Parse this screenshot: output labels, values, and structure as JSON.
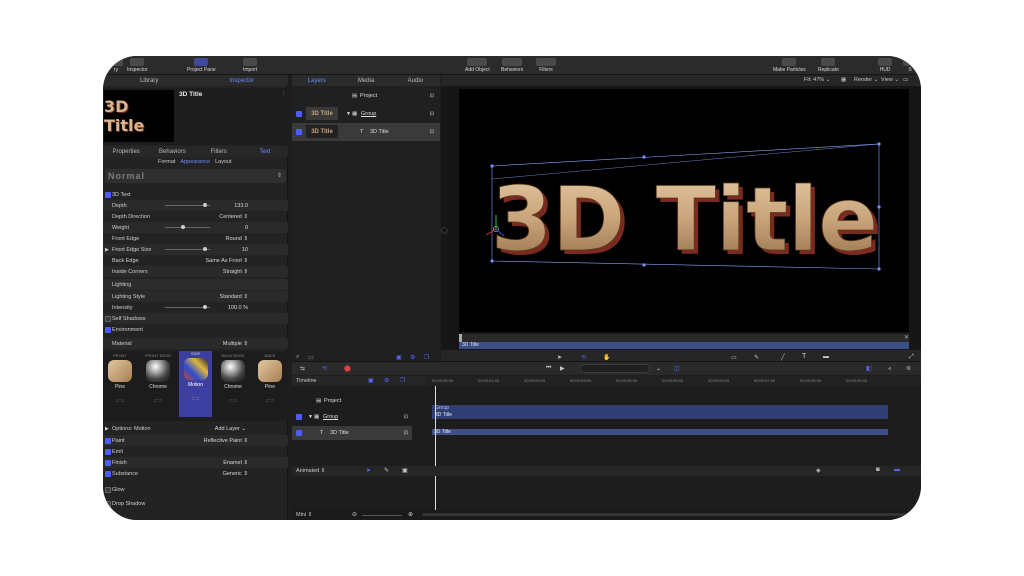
{
  "toolbar": {
    "left_items": [
      "ry",
      "Inspector",
      "Project Pane",
      "Import"
    ],
    "center_items": [
      "Add Object",
      "Behaviors",
      "Filters"
    ],
    "right_items": [
      "Make Particles",
      "Replicate",
      "HUD",
      "S"
    ]
  },
  "left_tabs": [
    "Library",
    "Inspector"
  ],
  "preview": {
    "thumb_text": "3D Title",
    "title": "3D Title"
  },
  "inspector_tabs": [
    "Properties",
    "Behaviors",
    "Filters",
    "Text"
  ],
  "inspector_subtabs": [
    "Format",
    "Appearance",
    "Layout"
  ],
  "preset": "Normal",
  "text_props": {
    "section_3d": "3D Text",
    "rows": [
      {
        "label": "Depth",
        "value": "133.0",
        "slider": 0.85
      },
      {
        "label": "Depth Direction",
        "value": "Centered ⇕"
      },
      {
        "label": "Weight",
        "value": "0",
        "slider": 0.38
      },
      {
        "label": "Front Edge",
        "value": "Round ⇕"
      },
      {
        "label": "Front Edge Size",
        "value": "10",
        "slider": 0.85
      },
      {
        "label": "Back Edge",
        "value": "Same As Front ⇕"
      },
      {
        "label": "Inside Corners",
        "value": "Straight ⇕"
      }
    ],
    "lighting_header": "Lighting",
    "lighting_rows": [
      {
        "label": "Lighting Style",
        "value": "Standard ⇕"
      },
      {
        "label": "Intensity",
        "value": "100.0 %",
        "slider": 0.85
      }
    ],
    "self_shadows": "Self Shadows",
    "environment": "Environment",
    "material_label": "Material",
    "material_value": "Multiple ⇕"
  },
  "materials": [
    {
      "head": "FRONT",
      "name": "Pine"
    },
    {
      "head": "FRONT EDGE",
      "name": "Chrome"
    },
    {
      "head": "SIDE",
      "name": "Motion"
    },
    {
      "head": "BACK EDGE",
      "name": "Chrome"
    },
    {
      "head": "BACK",
      "name": "Pine"
    }
  ],
  "options": {
    "label": "Options: Motion",
    "add_layer": "Add Layer ⌄"
  },
  "paint_rows": [
    {
      "label": "Paint",
      "value": "Reflective Paint ⇕"
    },
    {
      "label": "Emit",
      "value": ""
    },
    {
      "label": "Finish",
      "value": "Enamel ⇕"
    },
    {
      "label": "Substance",
      "value": "Generic ⇕"
    }
  ],
  "glow": "Glow",
  "drop_shadow": "Drop Shadow",
  "layers_tabs": [
    "Layers",
    "Media",
    "Audio"
  ],
  "layers": {
    "project": "Project",
    "group": "Group",
    "title": "3D Title",
    "thumb": "3D Title"
  },
  "viewer": {
    "fit": "Fit: 47% ⌄",
    "render": "Render ⌄",
    "view": "View ⌄",
    "text": "3D Title",
    "mini_label": "3D Title"
  },
  "timeline": {
    "title": "Timeline",
    "project": "Project",
    "group": "Group",
    "title_layer": "3D Title",
    "bar_group_name": "Group",
    "bar_group_sub": "3D Title",
    "bar_title": "3D Title",
    "animated": "Animated ⇕",
    "mini": "Mini ⇕",
    "timecodes": [
      "00:00:00:00",
      "00:00:01:00",
      "00:00:02:00",
      "00:00:03:00",
      "00:00:04:00",
      "00:00:05:00",
      "00:00:06:00",
      "00:00:07:00",
      "00:00:08:00",
      "00:00:09:00"
    ]
  },
  "colors": {
    "accent": "#4d5cff",
    "bar": "#3d4f86"
  }
}
